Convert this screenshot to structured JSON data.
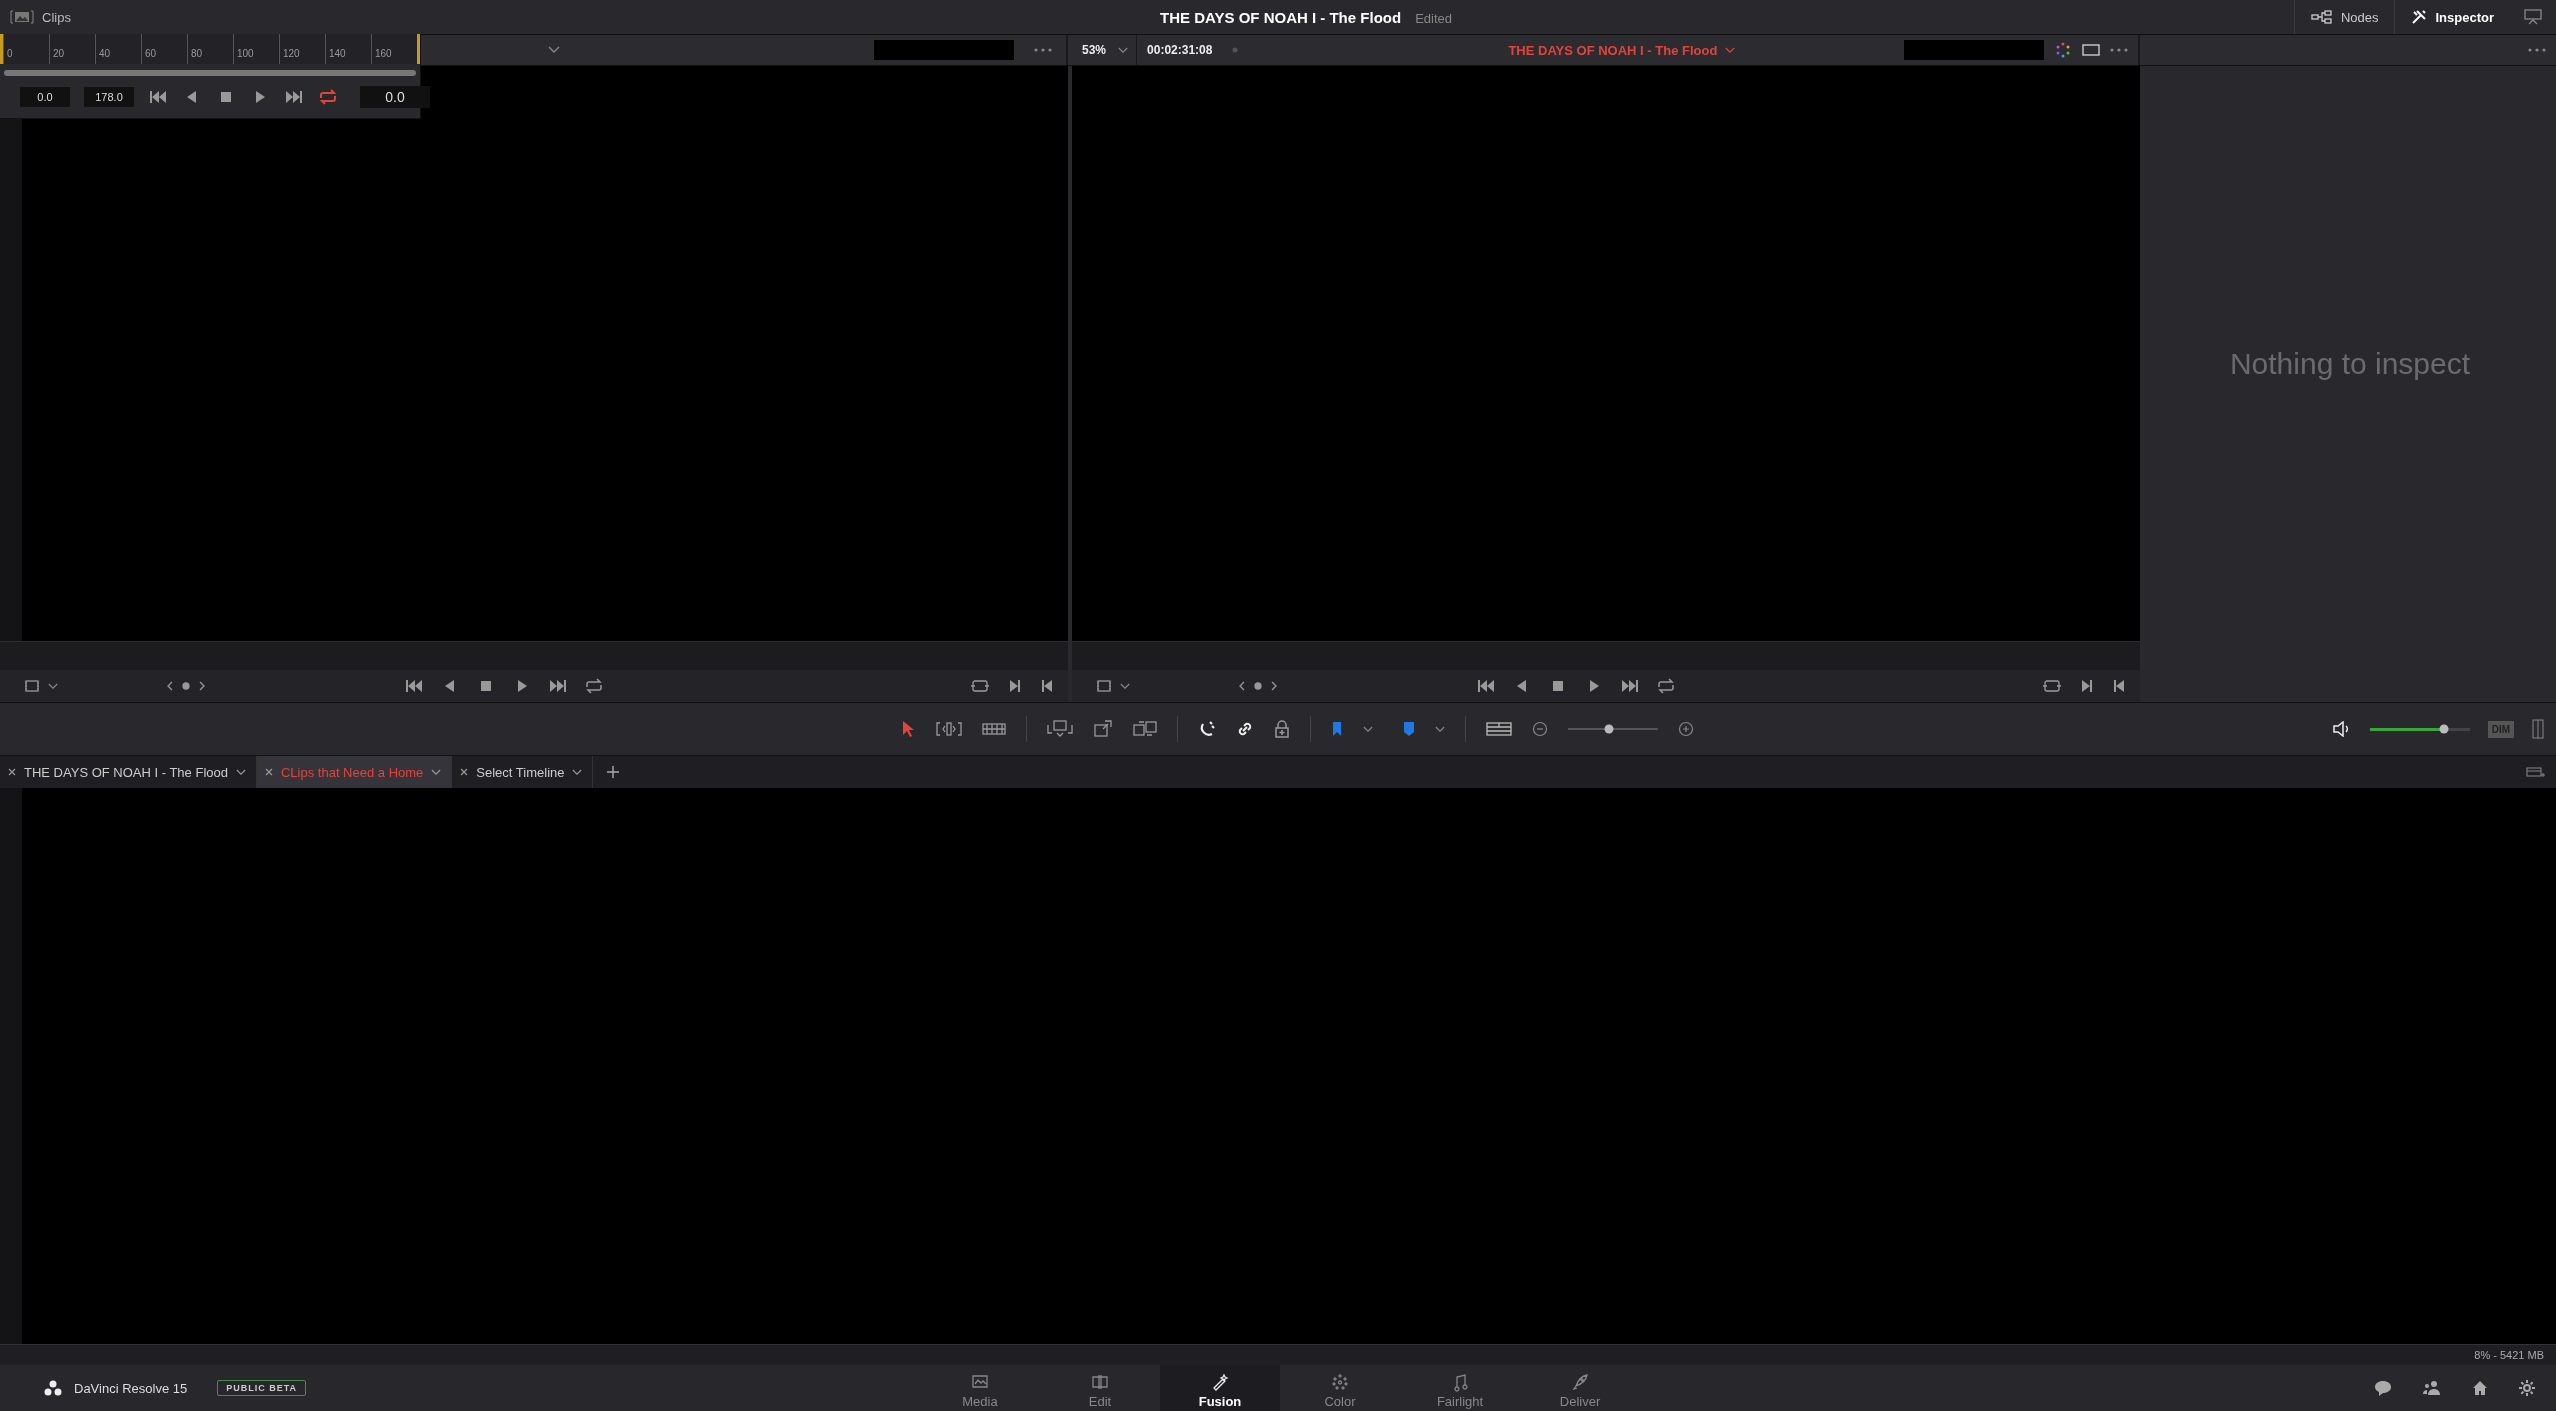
{
  "top_bar": {
    "panel_label": "Clips",
    "title": "THE DAYS OF NOAH I - The Flood",
    "status": "Edited",
    "buttons": [
      {
        "label": "Nodes",
        "kind": "nodes",
        "selected": false
      },
      {
        "label": "Inspector",
        "kind": "inspector",
        "selected": true
      }
    ]
  },
  "mini_timeline": {
    "ticks": [
      "0",
      "20",
      "40",
      "60",
      "80",
      "100",
      "120",
      "140",
      "160"
    ],
    "start": "0.0",
    "end": "178.0",
    "current": "0.0",
    "loop_on": true
  },
  "timeline_viewer": {
    "zoom": "53%",
    "timecode": "00:02:31:08",
    "title": "THE DAYS OF NOAH I - The Flood"
  },
  "inspector": {
    "message": "Nothing to inspect"
  },
  "toolbar": {
    "selection_tool_active": true,
    "zoom_slider": {
      "level": 0.45
    },
    "volume_slider": {
      "level": 0.74
    },
    "dim": "DIM"
  },
  "timeline_tabs": [
    {
      "label": "THE DAYS OF NOAH I - The Flood",
      "selected": false
    },
    {
      "label": "CLips that Need a Home",
      "selected": true
    },
    {
      "label": "Select Timeline",
      "selected": false
    }
  ],
  "status_bar": "8% - 5421 MB",
  "app": {
    "name": "DaVinci Resolve 15",
    "badge": "PUBLIC BETA"
  },
  "pages": [
    {
      "label": "Media",
      "kind": "media",
      "selected": false
    },
    {
      "label": "Edit",
      "kind": "edit",
      "selected": false
    },
    {
      "label": "Fusion",
      "kind": "fusion",
      "selected": true
    },
    {
      "label": "Color",
      "kind": "color",
      "selected": false
    },
    {
      "label": "Fairlight",
      "kind": "fairlight",
      "selected": false
    },
    {
      "label": "Deliver",
      "kind": "deliver",
      "selected": false
    }
  ]
}
